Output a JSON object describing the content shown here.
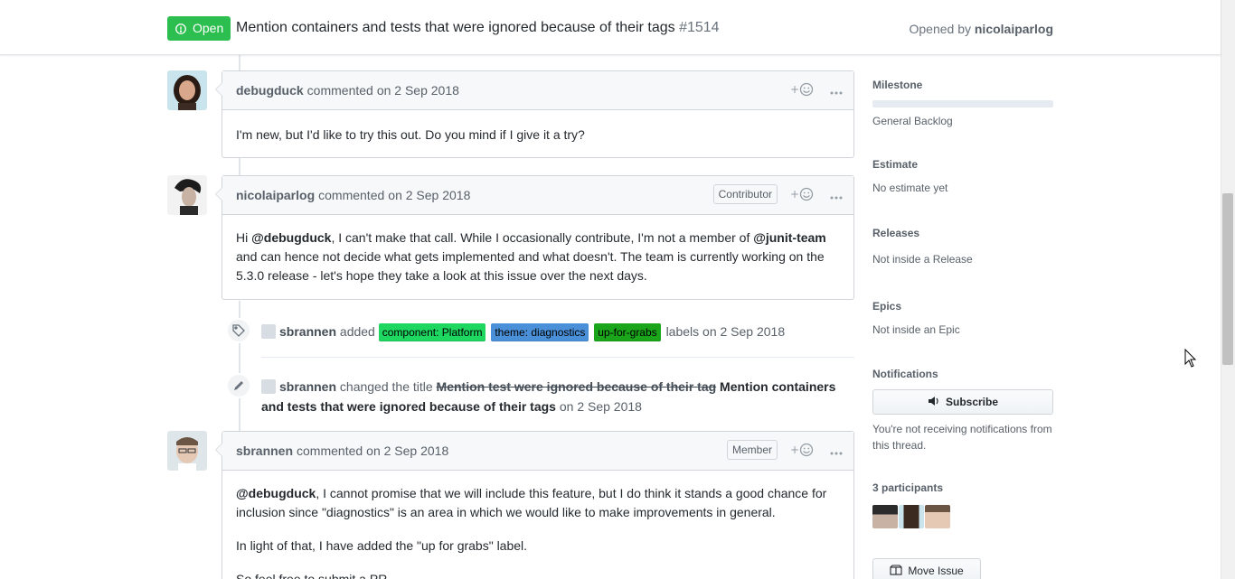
{
  "header": {
    "state": "Open",
    "title": "Mention containers and tests that were ignored because of their tags",
    "number": "#1514",
    "opened_prefix": "Opened by",
    "opened_by": "nicolaiparlog"
  },
  "comments": [
    {
      "author": "debugduck",
      "verb": "commented",
      "date": "on 2 Sep 2018",
      "badge": "",
      "body": [
        "I'm new, but I'd like to try this out. Do you mind if I give it a try?"
      ]
    },
    {
      "author": "nicolaiparlog",
      "verb": "commented",
      "date": "on 2 Sep 2018",
      "badge": "Contributor",
      "body_parts": {
        "p1": "Hi ",
        "m1": "@debugduck",
        "p2": ", I can't make that call. While I occasionally contribute, I'm not a member of ",
        "m2": "@junit-team",
        "p3": " and can hence not decide what gets implemented and what doesn't. The team is currently working on the 5.3.0 release - let's hope they take a look at this issue over the next days."
      }
    },
    {
      "author": "sbrannen",
      "verb": "commented",
      "date": "on 2 Sep 2018",
      "badge": "Member",
      "body_parts": {
        "m1": "@debugduck",
        "p1": ", I cannot promise that we will include this feature, but I do think it stands a good chance for inclusion since \"diagnostics\" is an area in which we would like to make improvements in general.",
        "p2": "In light of that, I have added the \"up for grabs\" label.",
        "p3": "So feel free to submit a PR."
      }
    }
  ],
  "events": {
    "labels": {
      "actor": "sbrannen",
      "verb": "added",
      "labels": [
        {
          "name": "component: Platform",
          "color": "#1ed760"
        },
        {
          "name": "theme: diagnostics",
          "color": "#4a90d9"
        },
        {
          "name": "up-for-grabs",
          "color": "#1aa51a"
        }
      ],
      "suffix": "labels",
      "date": "on 2 Sep 2018"
    },
    "rename": {
      "actor": "sbrannen",
      "verb": "changed the title",
      "old_title": "Mention test were ignored because of their tag",
      "new_title": "Mention containers and tests that were ignored because of their tags",
      "date": "on 2 Sep 2018"
    }
  },
  "sidebar": {
    "milestone_head": "Milestone",
    "milestone_value": "General Backlog",
    "estimate_head": "Estimate",
    "estimate_value": "No estimate yet",
    "releases_head": "Releases",
    "releases_value": "Not inside a Release",
    "epics_head": "Epics",
    "epics_value": "Not inside an Epic",
    "notifications_head": "Notifications",
    "subscribe_label": "Subscribe",
    "notifications_note": "You're not receiving notifications from this thread.",
    "participants_head": "3 participants",
    "move_issue_label": "Move Issue"
  },
  "colors": {
    "open_green": "#2cbe4e",
    "link": "#0366d6"
  }
}
